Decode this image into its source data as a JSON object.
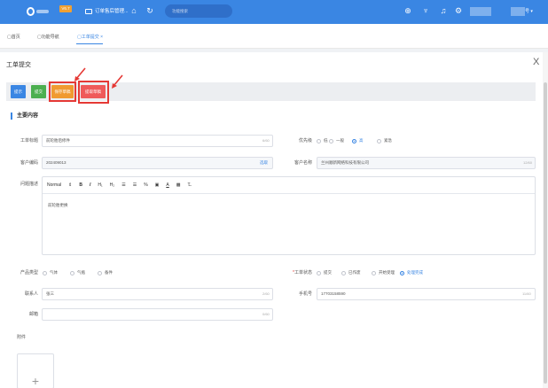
{
  "topbar": {
    "version_badge": "V6.7",
    "app_name": "订单售后管理...",
    "search_placeholder": "功能搜索",
    "user_suffix": "号 ▾",
    "color": "#3a86e3"
  },
  "breadcrumb": {
    "items": [
      "首页",
      "功能导航",
      "工单提交"
    ],
    "close_mark": "×"
  },
  "panel": {
    "title": "工单提交",
    "close": "X"
  },
  "toolbar": {
    "btn1": "提示",
    "btn2": "提交",
    "btn3": "保存草稿",
    "btn4": "提取草稿"
  },
  "section": {
    "title": "主要内容"
  },
  "form": {
    "title_label": "工单标题",
    "title_value": "前轮胎后修件",
    "title_count": "6/60",
    "priority_label": "优先级",
    "priority_options": [
      "低",
      "一般",
      "高",
      "紧急"
    ],
    "priority_selected": "高",
    "customer_code_label": "客户编码",
    "customer_code_value": "202409013",
    "customer_code_action": "选取",
    "customer_name_label": "客户名称",
    "customer_name_value": "兰州顺新网络科技有限公司",
    "customer_name_count": "12/60",
    "problem_label": "问题描述",
    "editor_tools": [
      "Normal",
      "⇕",
      "B",
      "I",
      "H₁",
      "H₂",
      "☰",
      "☰",
      "%",
      "▣",
      "A",
      "▩",
      "T̶"
    ],
    "problem_text": "前轮胎更换",
    "product_type_label": "产品类型",
    "product_type_options": [
      "气体",
      "气瓶",
      "备件"
    ],
    "status_label": "工单状态",
    "status_options": [
      "提交",
      "已作废",
      "开始受理",
      "处理完成"
    ],
    "status_selected": "处理完成",
    "contact_label": "联系人",
    "contact_value": "张三",
    "contact_count": "2/60",
    "phone_label": "手机号",
    "phone_value": "17703158590",
    "phone_count": "11/60",
    "email_label": "邮箱",
    "email_value": "",
    "email_count": "0/60",
    "attachment_label": "附件",
    "upload_plus": "+"
  }
}
